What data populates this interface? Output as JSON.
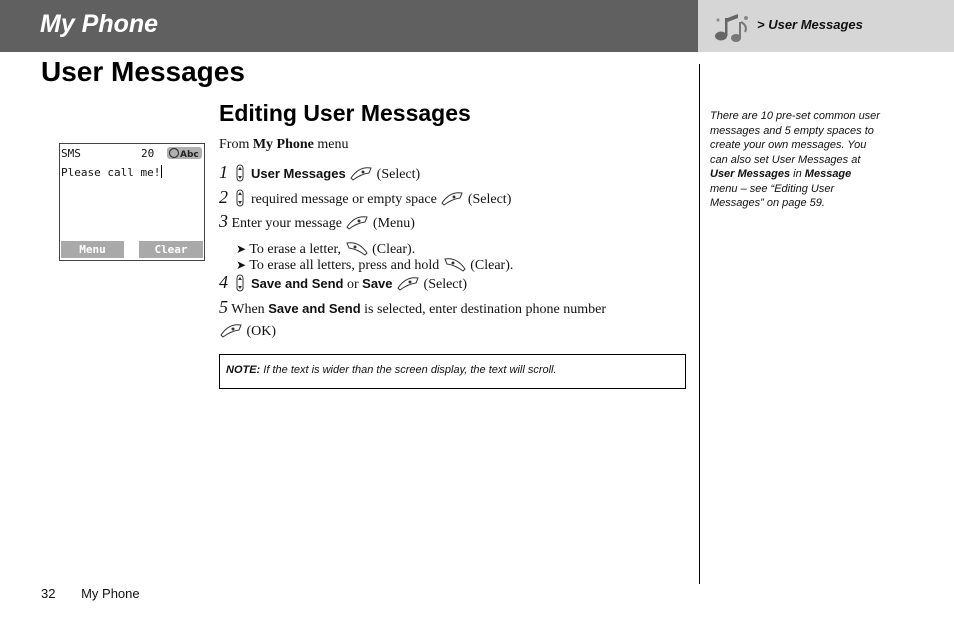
{
  "header": {
    "section_title": "My Phone",
    "breadcrumb": "> User Messages"
  },
  "page_title": "User Messages",
  "subsection_title": "Editing User Messages",
  "phone_screen": {
    "status_left": "SMS",
    "char_count": "20",
    "mode_indicator": "Abc",
    "message_text": "Please call me!",
    "softkey_left": "Menu",
    "softkey_right": "Clear"
  },
  "instructions": {
    "intro_prefix": "From",
    "intro_menu": "My Phone",
    "intro_suffix": "menu",
    "steps": [
      {
        "num": "1",
        "bold": "User Messages",
        "action": "(Select)"
      },
      {
        "num": "2",
        "text": "required message or empty space",
        "action": "(Select)"
      },
      {
        "num": "3",
        "text": "Enter your message",
        "action": "(Menu)"
      },
      {
        "num": "4",
        "bold_a": "Save and Send",
        "or": "or",
        "bold_b": "Save",
        "action": "(Select)"
      },
      {
        "num": "5",
        "prefix": "When",
        "bold": "Save and Send",
        "text": "is selected, enter destination phone number",
        "action": "(OK)"
      }
    ],
    "bullets": [
      {
        "text": "To erase a letter,",
        "action": "(Clear)."
      },
      {
        "text": "To erase all letters, press and hold",
        "action": "(Clear)."
      }
    ]
  },
  "note": {
    "label": "NOTE:",
    "text": "If the text is wider than the screen display, the text will scroll."
  },
  "sidebar": {
    "part1": "There are 10 pre-set common user messages and 5 empty spaces to create your own messages. You can also set User Messages at",
    "bold1": "User Messages",
    "in": "in",
    "bold2": "Message",
    "part2": "menu – see “Editing User Messages” on page 59."
  },
  "footer": {
    "page_number": "32",
    "section": "My Phone"
  }
}
